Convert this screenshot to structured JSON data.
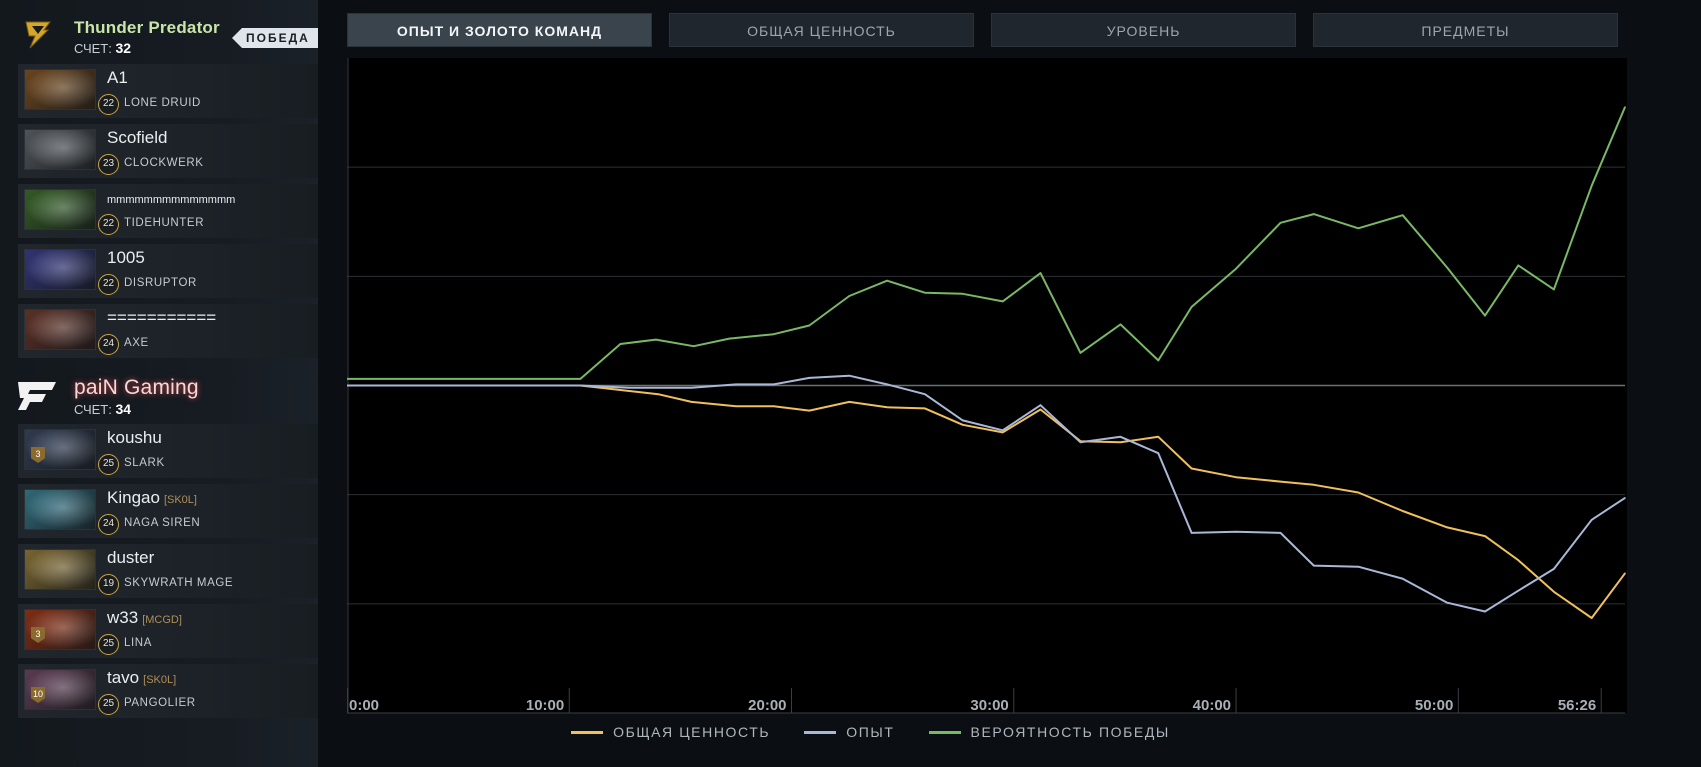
{
  "tabs": [
    {
      "label": "ОПЫТ И ЗОЛОТО КОМАНД",
      "active": true
    },
    {
      "label": "ОБЩАЯ ЦЕННОСТЬ",
      "active": false
    },
    {
      "label": "УРОВЕНЬ",
      "active": false
    },
    {
      "label": "ПРЕДМЕТЫ",
      "active": false
    }
  ],
  "teams": {
    "top": {
      "name": "Thunder Predator",
      "name_color": "#c9e6a8",
      "score_label": "СЧЕТ:",
      "score": "32",
      "badge": "ПОБЕДА",
      "players": [
        {
          "name": "A1",
          "tag": "",
          "level": "22",
          "hero": "LONE DRUID",
          "rank": "",
          "color": "#a36a2e"
        },
        {
          "name": "Scofield",
          "tag": "",
          "level": "23",
          "hero": "CLOCKWERK",
          "rank": "",
          "color": "#7a7f86"
        },
        {
          "name": "mmmmmmmmmmmmmm",
          "tag": "",
          "level": "22",
          "hero": "TIDEHUNTER",
          "rank": "",
          "color": "#4f8a3a"
        },
        {
          "name": "1005",
          "tag": "",
          "level": "22",
          "hero": "DISRUPTOR",
          "rank": "",
          "color": "#4a4fb0"
        },
        {
          "name": "===========",
          "tag": "",
          "level": "24",
          "hero": "AXE",
          "rank": "",
          "color": "#8a4a3a"
        }
      ]
    },
    "bottom": {
      "name": "paiN Gaming",
      "name_color": "#f3d9d9",
      "score_label": "СЧЕТ:",
      "score": "34",
      "players": [
        {
          "name": "koushu",
          "tag": "",
          "level": "25",
          "hero": "SLARK",
          "rank": "3",
          "color": "#4a5a7a"
        },
        {
          "name": "Kingao",
          "tag": "[SK0L]",
          "level": "24",
          "hero": "NAGA SIREN",
          "rank": "",
          "color": "#4aa0b8"
        },
        {
          "name": "duster",
          "tag": "",
          "level": "19",
          "hero": "SKYWRATH MAGE",
          "rank": "",
          "color": "#b89a4a"
        },
        {
          "name": "w33",
          "tag": "[MCGD]",
          "level": "25",
          "hero": "LINA",
          "rank": "3",
          "color": "#c2451e"
        },
        {
          "name": "tavo",
          "tag": "[SK0L]",
          "level": "25",
          "hero": "PANGOLIER",
          "rank": "10",
          "color": "#8a5a7a"
        }
      ]
    }
  },
  "chart_data": {
    "type": "line",
    "x_ticks": [
      "0:00",
      "10:00",
      "20:00",
      "30:00",
      "40:00",
      "50:00",
      "56:26"
    ],
    "x_tick_minutes": [
      0,
      10,
      20,
      30,
      40,
      50,
      56.43
    ],
    "xlim": [
      0,
      57.5
    ],
    "ylim": [
      -3,
      3
    ],
    "grid_y": [
      -3,
      -2,
      -1,
      0,
      1,
      2
    ],
    "series": [
      {
        "name": "ОБЩАЯ ЦЕННОСТЬ",
        "color": "#f0c05a",
        "x": [
          0,
          10.5,
          12.7,
          14,
          15.5,
          17.5,
          19.2,
          20.8,
          22.6,
          24.3,
          26,
          27.7,
          29.5,
          31.2,
          33,
          34.8,
          36.5,
          38,
          40,
          42,
          43.5,
          45.5,
          47.5,
          49.5,
          51.2,
          52.7,
          54.3,
          56,
          57.5
        ],
        "y": [
          0,
          0,
          -0.05,
          -0.08,
          -0.15,
          -0.19,
          -0.19,
          -0.23,
          -0.15,
          -0.2,
          -0.21,
          -0.36,
          -0.43,
          -0.22,
          -0.51,
          -0.52,
          -0.47,
          -0.76,
          -0.84,
          -0.88,
          -0.91,
          -0.98,
          -1.15,
          -1.3,
          -1.38,
          -1.6,
          -1.89,
          -2.13,
          -1.72
        ]
      },
      {
        "name": "ОПЫТ",
        "color": "#aab8d8",
        "x": [
          0,
          10.5,
          12.7,
          15.5,
          17.5,
          19.2,
          20.8,
          22.6,
          24.3,
          26,
          27.7,
          29.5,
          31.2,
          33,
          34.8,
          36.5,
          38,
          40,
          42,
          43.5,
          45.5,
          47.5,
          49.5,
          51.2,
          52.7,
          54.3,
          56,
          57.5
        ],
        "y": [
          0,
          0,
          -0.02,
          -0.02,
          0.01,
          0.01,
          0.07,
          0.09,
          0.01,
          -0.08,
          -0.32,
          -0.41,
          -0.18,
          -0.52,
          -0.47,
          -0.62,
          -1.35,
          -1.34,
          -1.35,
          -1.65,
          -1.66,
          -1.77,
          -1.99,
          -2.07,
          -1.88,
          -1.68,
          -1.23,
          -1.03
        ]
      },
      {
        "name": "ВЕРОЯТНОСТЬ ПОБЕДЫ",
        "color": "#79b865",
        "x": [
          0,
          10.5,
          12.3,
          13.9,
          15.6,
          17.2,
          19.2,
          20.8,
          22.6,
          24.3,
          26,
          27.7,
          29.5,
          31.2,
          33,
          34.8,
          36.5,
          38,
          40,
          42,
          43.5,
          45.5,
          47.5,
          49.5,
          51.2,
          52.7,
          54.3,
          56,
          57.5
        ],
        "y": [
          0.06,
          0.06,
          0.38,
          0.42,
          0.36,
          0.43,
          0.47,
          0.55,
          0.82,
          0.96,
          0.85,
          0.84,
          0.77,
          1.03,
          0.3,
          0.56,
          0.23,
          0.72,
          1.07,
          1.49,
          1.57,
          1.44,
          1.56,
          1.08,
          0.64,
          1.1,
          0.88,
          1.83,
          2.55
        ]
      }
    ],
    "legend_position": "bottom-center"
  }
}
